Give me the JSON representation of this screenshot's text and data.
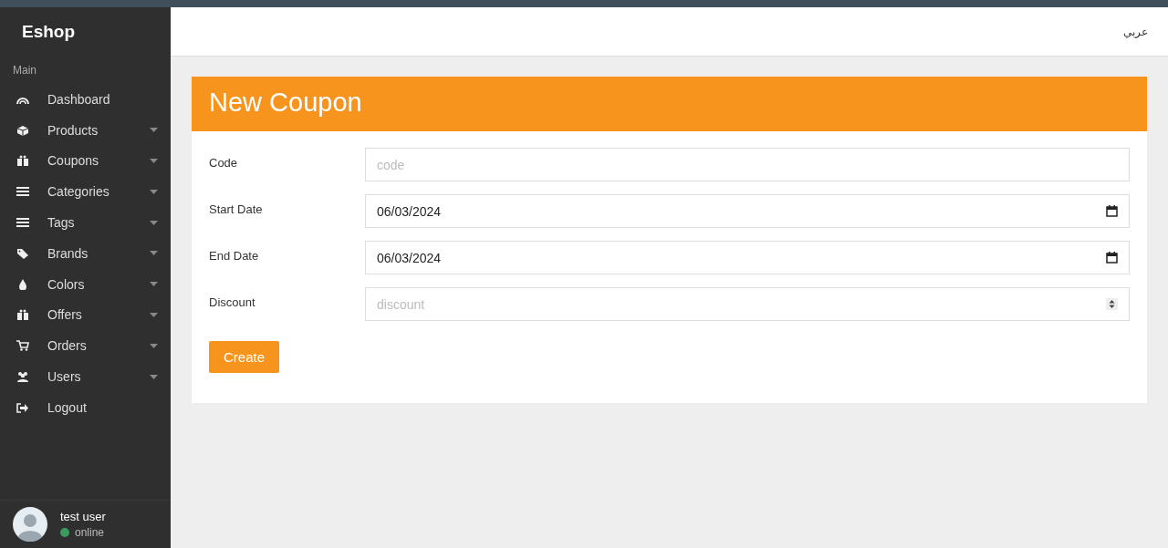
{
  "sidebar": {
    "brand": "Eshop",
    "section": "Main",
    "items": [
      {
        "label": "Dashboard",
        "has_submenu": false
      },
      {
        "label": "Products",
        "has_submenu": true
      },
      {
        "label": "Coupons",
        "has_submenu": true
      },
      {
        "label": "Categories",
        "has_submenu": true
      },
      {
        "label": "Tags",
        "has_submenu": true
      },
      {
        "label": "Brands",
        "has_submenu": true
      },
      {
        "label": "Colors",
        "has_submenu": true
      },
      {
        "label": "Offers",
        "has_submenu": true
      },
      {
        "label": "Orders",
        "has_submenu": true
      },
      {
        "label": "Users",
        "has_submenu": true
      },
      {
        "label": "Logout",
        "has_submenu": false
      }
    ],
    "user": {
      "name": "test user",
      "status": "online",
      "color": "#3c9a5f"
    }
  },
  "topbar": {
    "language": "عربي"
  },
  "form": {
    "title": "New Coupon",
    "fields": [
      {
        "label": "Code",
        "kind": "text",
        "placeholder": "code"
      },
      {
        "label": "Start Date",
        "kind": "date",
        "value": "06/03/2024"
      },
      {
        "label": "End Date",
        "kind": "date",
        "value": "06/03/2024"
      },
      {
        "label": "Discount",
        "kind": "number",
        "placeholder": "discount"
      }
    ],
    "submit": "Create"
  }
}
